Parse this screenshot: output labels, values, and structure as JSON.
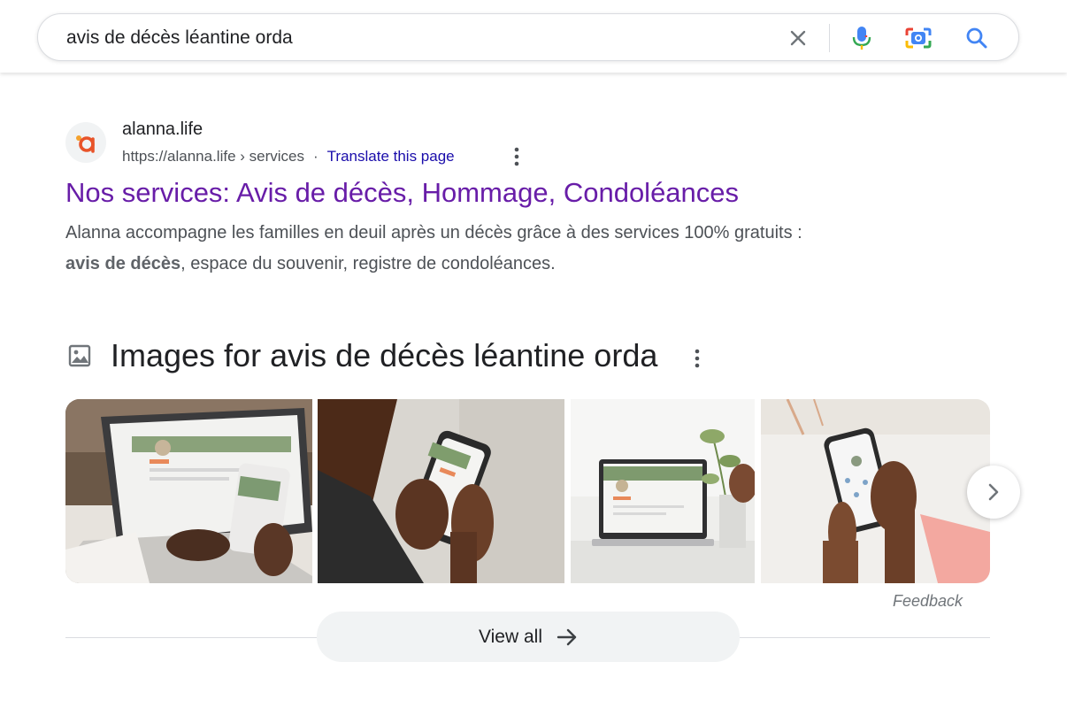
{
  "search": {
    "query": "avis de décès léantine orda",
    "icons": [
      "close-icon",
      "mic-icon",
      "lens-icon",
      "search-icon"
    ]
  },
  "result": {
    "site_name": "alanna.life",
    "url": "https://alanna.life",
    "breadcrumb": "› services",
    "separator": "·",
    "translate_label": "Translate this page",
    "title": "Nos services: Avis de décès, Hommage, Condoléances",
    "snippet_line1": "Alanna accompagne les familles en deuil après un décès grâce à des services 100% gratuits :",
    "snippet_bold": "avis de décès",
    "snippet_rest": ", espace du souvenir, registre de condoléances.",
    "favicon_letter": "a",
    "colors": {
      "title": "#681da8",
      "link": "#1a0dab",
      "favicon": "#e8542a"
    }
  },
  "images": {
    "heading": "Images for avis de décès léantine orda",
    "feedback_label": "Feedback",
    "view_all_label": "View all",
    "thumbnails": [
      "laptop-and-phone-photo",
      "hand-holding-phone-photo",
      "laptop-with-plant-photo",
      "phone-in-hands-photo"
    ]
  }
}
